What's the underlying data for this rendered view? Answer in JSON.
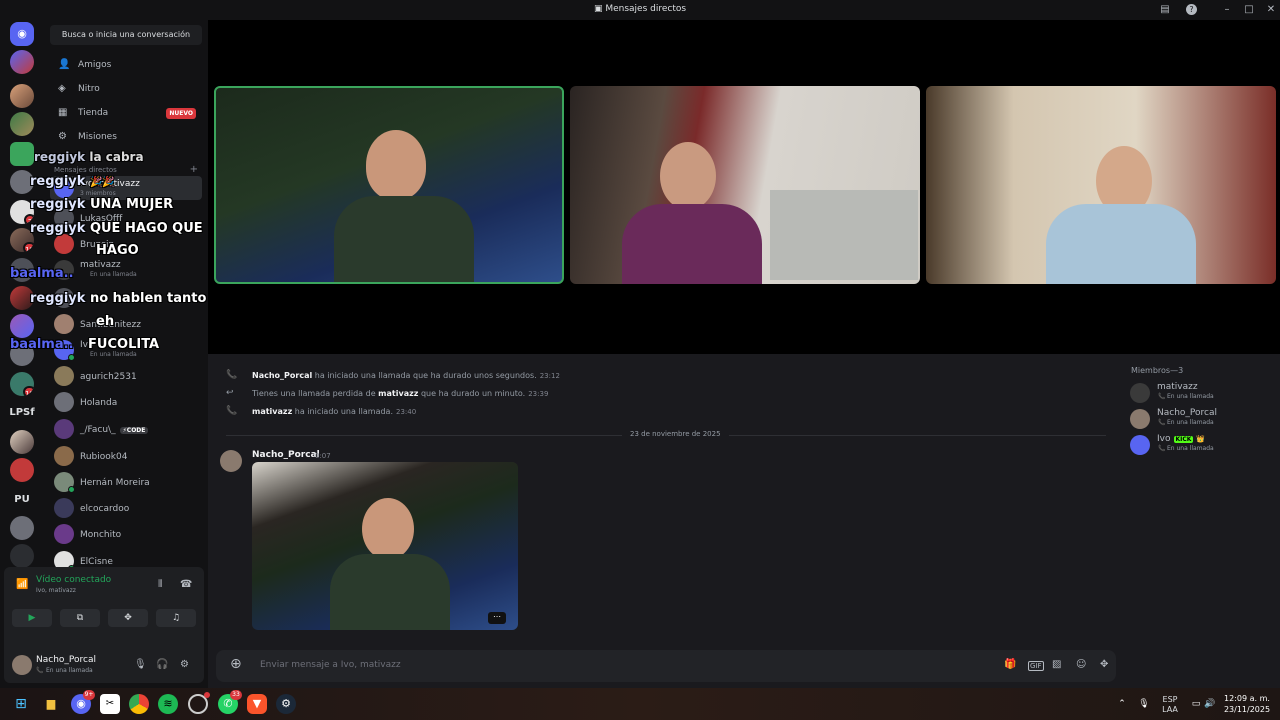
{
  "window": {
    "title": "Mensajes directos"
  },
  "server_rail": {
    "badges": [
      "3",
      "10",
      "18"
    ],
    "text_servers": [
      "LPSf",
      "PU"
    ]
  },
  "sidebar": {
    "search_placeholder": "Busca o inicia una conversación",
    "nav": [
      {
        "label": "Amigos",
        "icon": "friends-icon"
      },
      {
        "label": "Nitro",
        "icon": "nitro-icon"
      },
      {
        "label": "Tienda",
        "icon": "shop-icon",
        "badge": "NUEVO"
      },
      {
        "label": "Misiones",
        "icon": "quests-icon"
      }
    ],
    "dm_header": "Mensajes directos",
    "dms": [
      {
        "name": "Ivo, mativazz",
        "sub": "3 miembros"
      },
      {
        "name": "LukasOfff",
        "sub": ""
      },
      {
        "name": "Brunsin",
        "sub": ""
      },
      {
        "name": "mativazz",
        "sub": "En una llamada"
      },
      {
        "name": "",
        "sub": ""
      },
      {
        "name": "Santibenitezz",
        "sub": ""
      },
      {
        "name": "Ivo",
        "sub": "En una llamada"
      },
      {
        "name": "agurich2531",
        "sub": ""
      },
      {
        "name": "Holanda",
        "sub": ""
      },
      {
        "name": "_/Facu\\_",
        "sub": "",
        "tag": "⚡CODE"
      },
      {
        "name": "Rubiook04",
        "sub": ""
      },
      {
        "name": "Hernán Moreira",
        "sub": ""
      },
      {
        "name": "elcocardoo",
        "sub": ""
      },
      {
        "name": "Monchito",
        "sub": ""
      },
      {
        "name": "ElCisne",
        "sub": ""
      },
      {
        "name": "thiagoso",
        "sub": ""
      }
    ]
  },
  "voice_panel": {
    "status": "Vídeo conectado",
    "channel": "Ivo, mativazz"
  },
  "user_panel": {
    "username": "Nacho_Porcal",
    "status": "En una llamada"
  },
  "overlay_chat": [
    {
      "user": "reggiyk",
      "text": "la cabra"
    },
    {
      "user": "reggiyk",
      "text": "🎉🎉"
    },
    {
      "user": "reggiyk",
      "text": "UNA MUJER"
    },
    {
      "user": "reggiyk",
      "text": "QUE HAGO QUE"
    },
    {
      "user": "",
      "text": "HAGO"
    },
    {
      "user": "baalma..",
      "text": ""
    },
    {
      "user": "reggiyk",
      "text": "no hablen tanto"
    },
    {
      "user": "",
      "text": "eh"
    },
    {
      "user": "baalma..",
      "text": "FUCOLITA"
    }
  ],
  "chat": {
    "system_messages": [
      {
        "actor": "Nacho_Porcal",
        "text": "ha iniciado una llamada que ha durado unos segundos.",
        "time": "23:12",
        "icon": "phone-icon"
      },
      {
        "prefix": "Tienes una llamada perdida de",
        "actor": "mativazz",
        "text": "que ha durado un minuto.",
        "time": "23:39",
        "icon": "missed-call-icon"
      },
      {
        "actor": "mativazz",
        "text": "ha iniciado una llamada.",
        "time": "23:40",
        "icon": "phone-icon"
      }
    ],
    "date_divider": "23 de noviembre de 2025",
    "message": {
      "author": "Nacho_Porcal",
      "time": "0:07"
    },
    "input_placeholder": "Enviar mensaje a Ivo, mativazz",
    "input_icons": [
      "gift-icon",
      "gif-icon",
      "sticker-icon",
      "emoji-icon",
      "apps-icon"
    ]
  },
  "members": {
    "header": "Miembros—3",
    "list": [
      {
        "name": "mativazz",
        "status": "En una llamada"
      },
      {
        "name": "Nacho_Porcal",
        "status": "En una llamada"
      },
      {
        "name": "Ivo",
        "status": "En una llamada",
        "tag": "KICK",
        "crown": "👑"
      }
    ]
  },
  "taskbar": {
    "badges": {
      "discord": "9+",
      "whatsapp": "33"
    },
    "lang": [
      "ESP",
      "LAA"
    ],
    "time": "12:09 a. m.",
    "date": "23/11/2025"
  },
  "colors": {
    "accent_green": "#23a55a",
    "discord_blurple": "#5865f2",
    "danger_red": "#da373c",
    "bg_dark": "#121214",
    "bg_chat": "#1a1a1e"
  }
}
